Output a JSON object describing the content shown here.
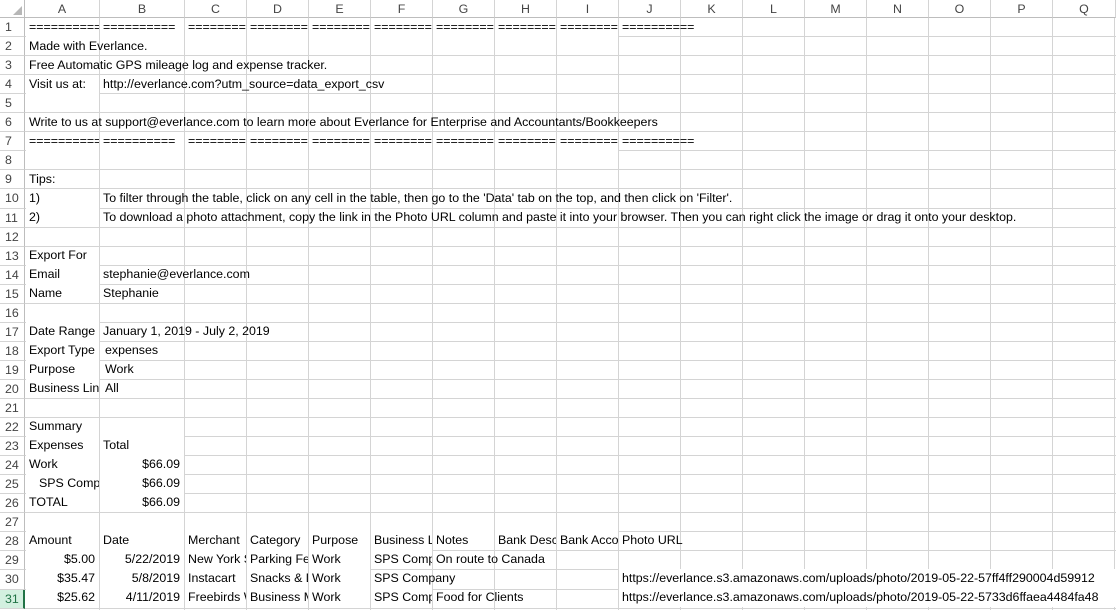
{
  "columns": [
    "A",
    "B",
    "C",
    "D",
    "E",
    "F",
    "G",
    "H",
    "I",
    "J",
    "K",
    "L",
    "M",
    "N",
    "O",
    "P",
    "Q"
  ],
  "rows": [
    "1",
    "2",
    "3",
    "4",
    "5",
    "6",
    "7",
    "8",
    "9",
    "10",
    "11",
    "12",
    "13",
    "14",
    "15",
    "16",
    "17",
    "18",
    "19",
    "20",
    "21",
    "22",
    "23",
    "24",
    "25",
    "26",
    "27",
    "28",
    "29",
    "30",
    "31"
  ],
  "cells": {
    "r1_a": "==========",
    "r1_b": "==========",
    "r1_c": "==========",
    "r1_d": "==========",
    "r1_e": "==========",
    "r1_f": "==========",
    "r1_g": "==========",
    "r1_h": "==========",
    "r1_i": "==========",
    "r1_j": "==========",
    "r2_a": "Made with Everlance.",
    "r3_a": "Free Automatic GPS mileage log and expense tracker.",
    "r4_a": "Visit us at:",
    "r4_b": "http://everlance.com?utm_source=data_export_csv",
    "r6_a": "Write to us at support@everlance.com to learn more about Everlance for Enterprise and Accountants/Bookkeepers",
    "r7_a": "==========",
    "r7_b": "==========",
    "r7_c": "==========",
    "r7_d": "==========",
    "r7_e": "==========",
    "r7_f": "==========",
    "r7_g": "==========",
    "r7_h": "==========",
    "r7_i": "==========",
    "r7_j": "==========",
    "r9_a": "Tips:",
    "r10_a": "1)",
    "r10_b": "To filter through the table, click on any cell in the table, then go to the 'Data' tab on the top, and then click on 'Filter'.",
    "r11_a": "2)",
    "r11_b": "To download a photo attachment, copy the link in the Photo URL column and paste it into your browser. Then you can right click the image or drag it onto your desktop.",
    "r13_a": "Export For",
    "r14_a": "Email",
    "r14_b": "stephanie@everlance.com",
    "r15_a": "Name",
    "r15_b": "Stephanie",
    "r17_a": "Date Range",
    "r17_b": "January  1, 2019 - July  2, 2019",
    "r18_a": "Export Type",
    "r18_b": "expenses",
    "r19_a": "Purpose",
    "r19_b": "Work",
    "r20_a": "Business Line",
    "r20_b": "All",
    "r22_a": "Summary",
    "r23_a": "Expenses",
    "r23_b": "Total",
    "r24_a": "Work",
    "r24_b": "$66.09",
    "r25_a": "SPS Company",
    "r25_b": "$66.09",
    "r26_a": "TOTAL",
    "r26_b": "$66.09",
    "r28_a": "Amount",
    "r28_b": "Date",
    "r28_c": "Merchant",
    "r28_d": "Category",
    "r28_e": "Purpose",
    "r28_f": "Business Line",
    "r28_g": "Notes",
    "r28_h": "Bank Description",
    "r28_i": "Bank Account",
    "r28_j": "Photo URL",
    "r29_a": "$5.00",
    "r29_b": "5/22/2019",
    "r29_c": "New York State",
    "r29_d": "Parking Fees",
    "r29_e": "Work",
    "r29_f": "SPS Company",
    "r29_g": "On route to Canada",
    "r30_a": "$35.47",
    "r30_b": "5/8/2019",
    "r30_c": "Instacart",
    "r30_d": "Snacks & Drinks",
    "r30_e": "Work",
    "r30_f": "SPS Company",
    "r30_j": "https://everlance.s3.amazonaws.com/uploads/photo/2019-05-22-57ff4ff290004d59912",
    "r31_a": "$25.62",
    "r31_b": "4/11/2019",
    "r31_c": "Freebirds World Burrito",
    "r31_d": "Business Meals",
    "r31_e": "Work",
    "r31_f": "SPS Company",
    "r31_g": "Food for Clients",
    "r31_j": "https://everlance.s3.amazonaws.com/uploads/photo/2019-05-22-5733d6ffaea4484fa48"
  }
}
